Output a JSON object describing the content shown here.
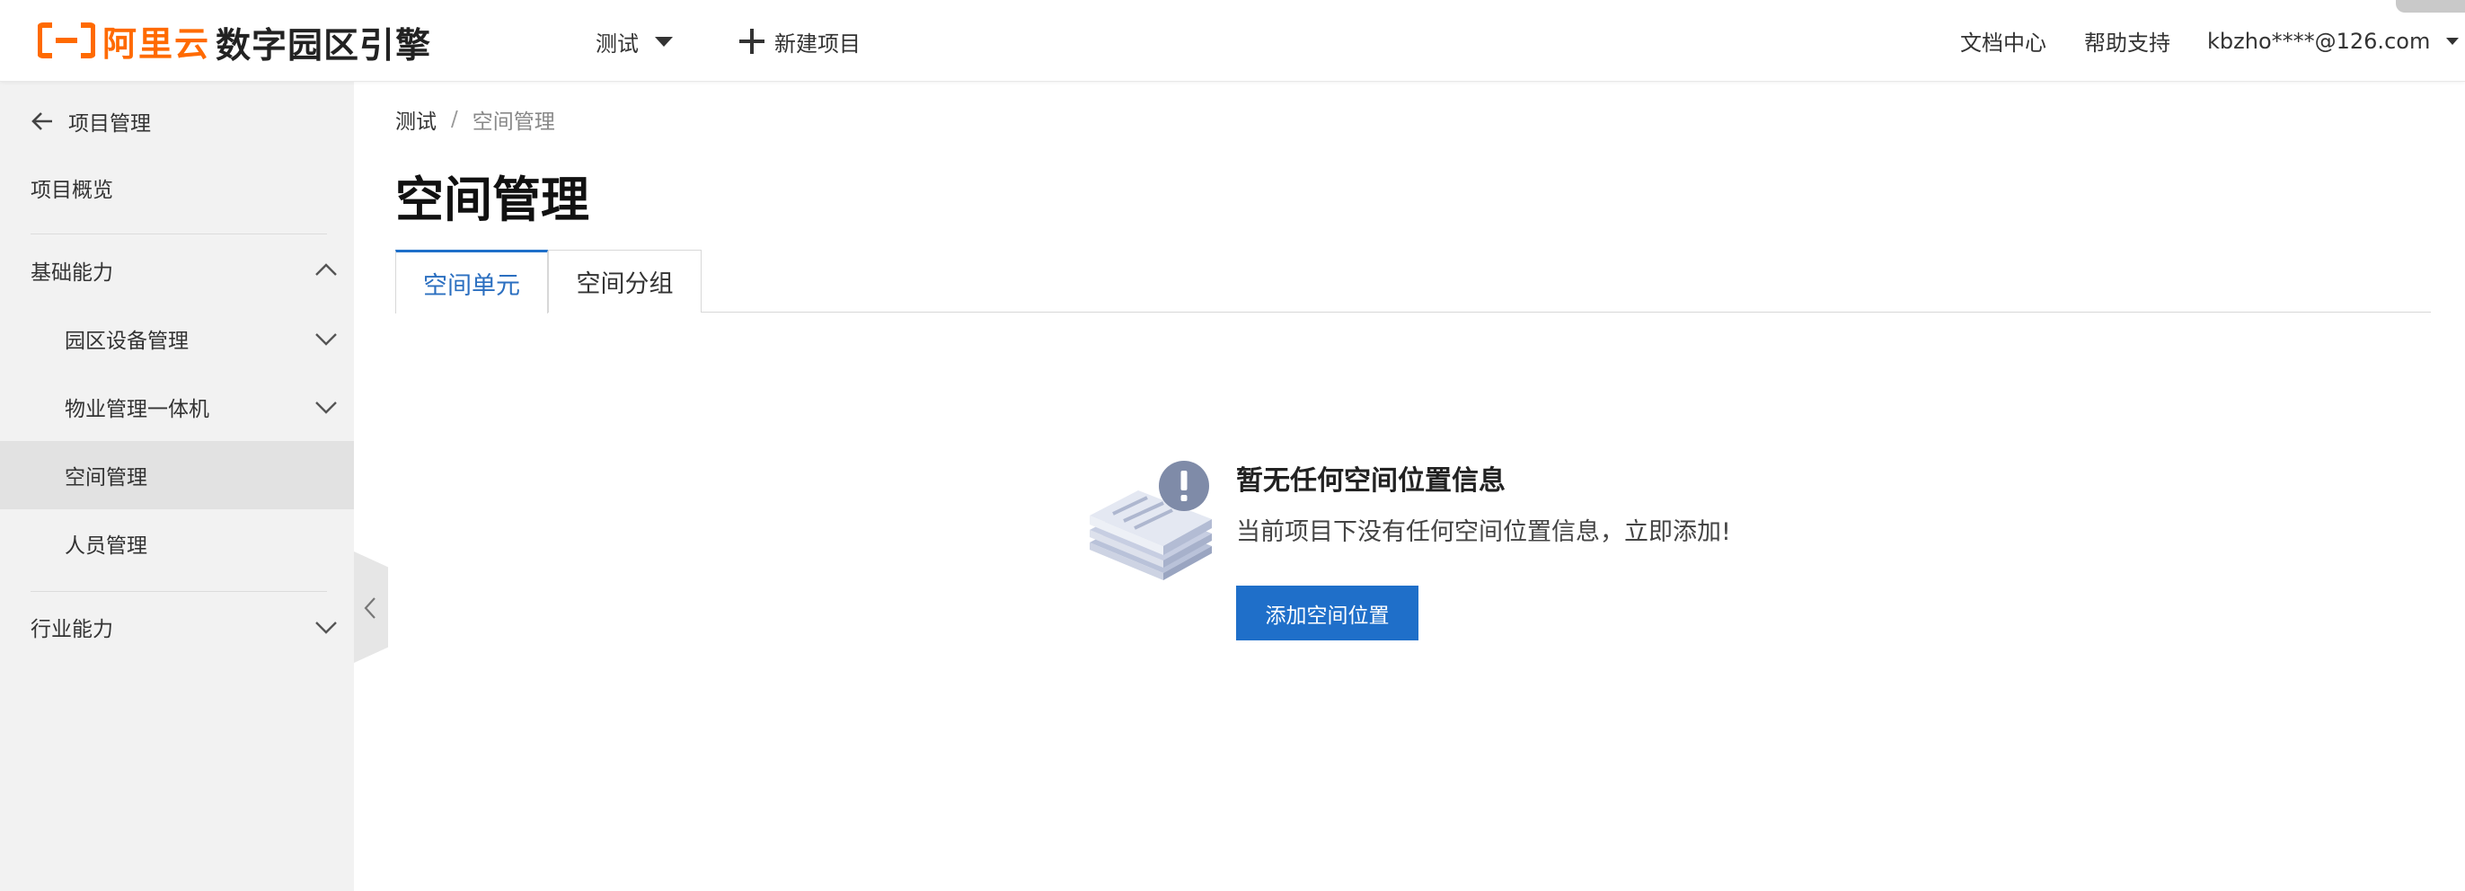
{
  "header": {
    "logo_text": "阿里云",
    "product_name": "数字园区引擎",
    "project_selector": "测试",
    "new_project_label": "新建项目",
    "links": [
      "文档中心",
      "帮助支持"
    ],
    "user": "kbzho****@126.com",
    "brand_color": "#ff6a00"
  },
  "sidebar": {
    "back_label": "项目管理",
    "overview": "项目概览",
    "groups": [
      {
        "label": "基础能力",
        "expanded": true
      },
      {
        "label": "行业能力",
        "expanded": false
      }
    ],
    "items": [
      {
        "label": "园区设备管理",
        "expandable": true
      },
      {
        "label": "物业管理一体机",
        "expandable": true
      },
      {
        "label": "空间管理",
        "active": true
      },
      {
        "label": "人员管理"
      }
    ]
  },
  "breadcrumb": {
    "root": "测试",
    "separator": "/",
    "current": "空间管理"
  },
  "page": {
    "title": "空间管理",
    "tabs": [
      {
        "label": "空间单元",
        "active": true
      },
      {
        "label": "空间分组",
        "active": false
      }
    ]
  },
  "empty_state": {
    "icon": "empty-warning-icon",
    "title": "暂无任何空间位置信息",
    "description": "当前项目下没有任何空间位置信息，立即添加!",
    "button_label": "添加空间位置",
    "button_color": "#1f6fc9"
  }
}
